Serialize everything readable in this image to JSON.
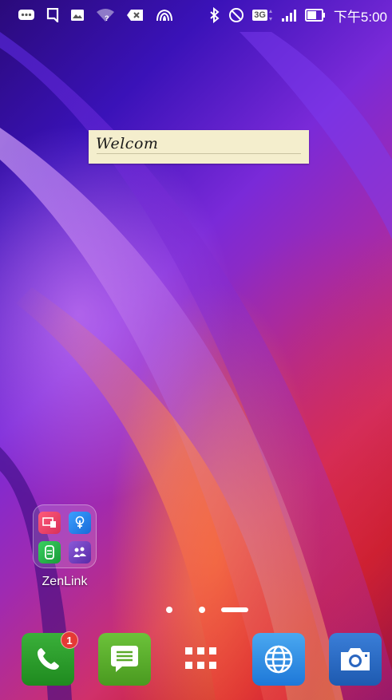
{
  "status_bar": {
    "time": "下午5:00",
    "network_label": "3G",
    "icons": [
      "messages-icon",
      "notification-icon",
      "image-icon",
      "wifi-unknown-icon",
      "keyboard-delete-icon",
      "nfc-icon",
      "bluetooth-icon",
      "do-not-disturb-icon",
      "network-3g-icon",
      "signal-icon",
      "battery-icon"
    ]
  },
  "note_widget": {
    "text": "Welcom"
  },
  "folder": {
    "label": "ZenLink",
    "apps": [
      "share-link-icon",
      "remote-link-icon",
      "pc-link-icon",
      "party-link-icon"
    ]
  },
  "page_indicator": {
    "pages": 3,
    "current": 3
  },
  "dock": {
    "apps": [
      {
        "name": "phone-app",
        "icon": "phone-icon",
        "color": "#2e9b2e",
        "badge": "1"
      },
      {
        "name": "messaging-app",
        "icon": "message-icon",
        "color": "#5fb32e"
      },
      {
        "name": "all-apps",
        "icon": "apps-grid-icon"
      },
      {
        "name": "browser-app",
        "icon": "globe-icon",
        "color": "#2f8fe6"
      },
      {
        "name": "camera-app",
        "icon": "camera-icon",
        "color": "#2a6fc9"
      }
    ]
  }
}
